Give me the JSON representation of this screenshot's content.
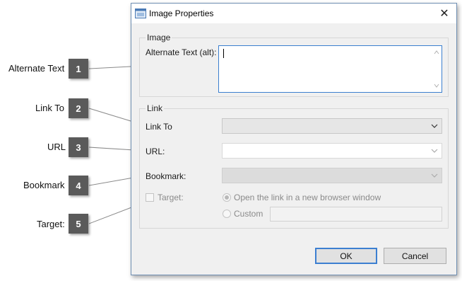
{
  "callouts": [
    {
      "number": "1",
      "label": "Alternate Text"
    },
    {
      "number": "2",
      "label": "Link To"
    },
    {
      "number": "3",
      "label": "URL"
    },
    {
      "number": "4",
      "label": "Bookmark"
    },
    {
      "number": "5",
      "label": "Target:"
    }
  ],
  "dialog": {
    "title": "Image Properties",
    "close_glyph": "✕",
    "image_group": {
      "legend": "Image",
      "alt_label": "Alternate Text (alt):",
      "alt_value": ""
    },
    "link_group": {
      "legend": "Link",
      "link_to_label": "Link To",
      "link_to_value": "",
      "url_label": "URL:",
      "url_value": "",
      "bookmark_label": "Bookmark:",
      "bookmark_value": "",
      "target_label": "Target:",
      "target_checked": false,
      "radio_new_window_label": "Open the link in a new browser window",
      "radio_custom_label": "Custom",
      "custom_value": ""
    },
    "ok_label": "OK",
    "cancel_label": "Cancel"
  },
  "colors": {
    "callout_badge": "#5a5a5a",
    "focus_border": "#3b7fcf",
    "dialog_border": "#6f8fb3"
  },
  "icons": {
    "title_icon": "window-icon",
    "close": "close-icon",
    "dropdown": "chevron-down-icon"
  }
}
